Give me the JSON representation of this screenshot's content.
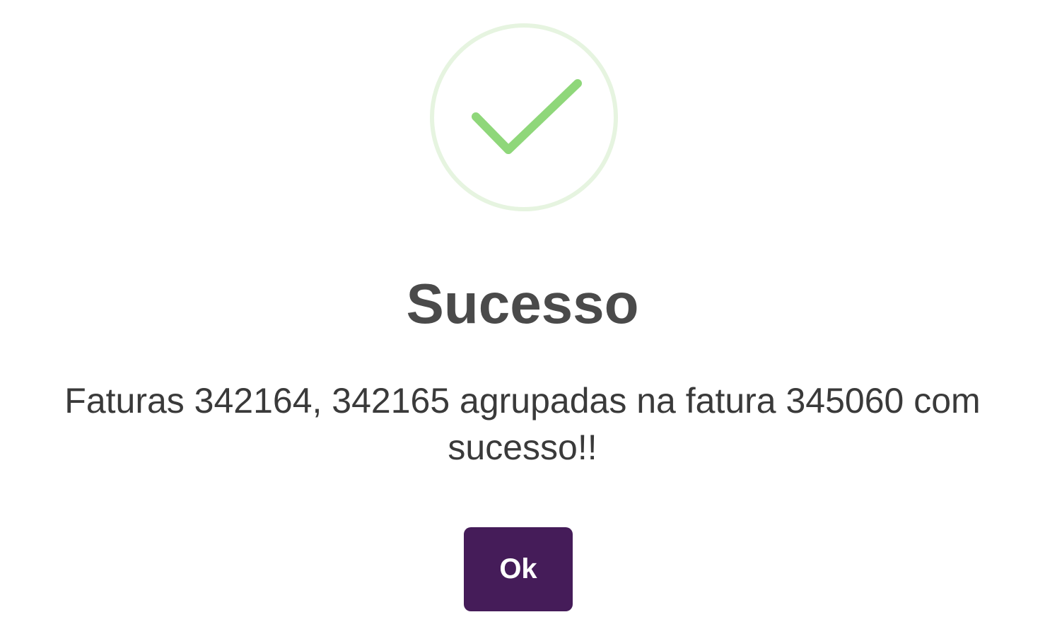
{
  "dialog": {
    "icon": "success-check-icon",
    "title": "Sucesso",
    "message": "Faturas 342164, 342165 agrupadas na fatura 345060 com sucesso!!",
    "ok_label": "Ok"
  },
  "colors": {
    "success_green": "#8fd77a",
    "success_ring": "#e6f4e0",
    "button_background": "#451c59",
    "title_text": "#4a4a4a"
  }
}
